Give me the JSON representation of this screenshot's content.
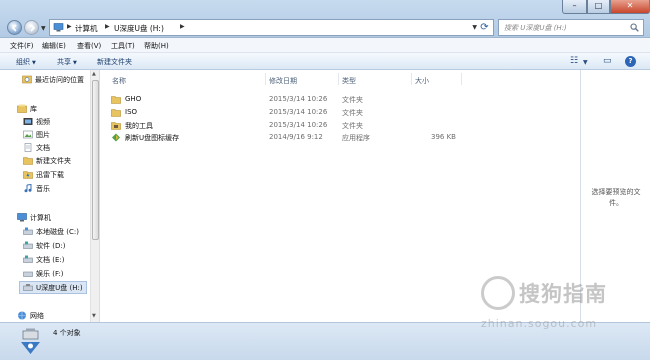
{
  "address": {
    "crumbs": [
      "计算机",
      "U深度U盘 (H:)"
    ]
  },
  "search": {
    "placeholder": "搜索 U深度U盘 (H:)"
  },
  "menu": [
    "文件(F)",
    "编辑(E)",
    "查看(V)",
    "工具(T)",
    "帮助(H)"
  ],
  "toolbar": {
    "organize": "组织",
    "share": "共享",
    "new_folder": "新建文件夹"
  },
  "sidebar": {
    "items": [
      {
        "label": "最近访问的位置",
        "icon": "recent-places-icon"
      },
      {
        "label": "库",
        "icon": "library-icon"
      },
      {
        "label": "视频",
        "icon": "video-library-icon"
      },
      {
        "label": "图片",
        "icon": "pictures-library-icon"
      },
      {
        "label": "文档",
        "icon": "documents-library-icon"
      },
      {
        "label": "新建文件夹",
        "icon": "folder-icon"
      },
      {
        "label": "迅雷下载",
        "icon": "thunder-download-icon"
      },
      {
        "label": "音乐",
        "icon": "music-library-icon"
      },
      {
        "label": "计算机",
        "icon": "computer-icon"
      },
      {
        "label": "本地磁盘 (C:)",
        "icon": "drive-icon"
      },
      {
        "label": "软件 (D:)",
        "icon": "drive-icon"
      },
      {
        "label": "文档 (E:)",
        "icon": "drive-icon"
      },
      {
        "label": "娱乐 (F:)",
        "icon": "drive-icon"
      },
      {
        "label": "U深度U盘 (H:)",
        "icon": "usb-drive-icon"
      },
      {
        "label": "网络",
        "icon": "network-icon"
      }
    ]
  },
  "columns": {
    "name": "名称",
    "date": "修改日期",
    "type": "类型",
    "size": "大小"
  },
  "files": [
    {
      "name": "GHO",
      "date": "2015/3/14 10:26",
      "type": "文件夹",
      "size": "",
      "icon": "folder-icon"
    },
    {
      "name": "ISO",
      "date": "2015/3/14 10:26",
      "type": "文件夹",
      "size": "",
      "icon": "folder-icon"
    },
    {
      "name": "我的工具",
      "date": "2015/3/14 10:26",
      "type": "文件夹",
      "size": "",
      "icon": "tools-folder-icon"
    },
    {
      "name": "刷新U盘图标缓存",
      "date": "2014/9/16 9:12",
      "type": "应用程序",
      "size": "396 KB",
      "icon": "application-icon"
    }
  ],
  "preview": {
    "text": "选择要预览的文件。"
  },
  "status": {
    "text": "4 个对象"
  },
  "watermark": {
    "brand": "搜狗指南",
    "url": "zhinan.sogou.com"
  },
  "colors": {
    "folder": "#e8c460",
    "accent": "#2c65b5",
    "selected": "#dbe6f4"
  }
}
